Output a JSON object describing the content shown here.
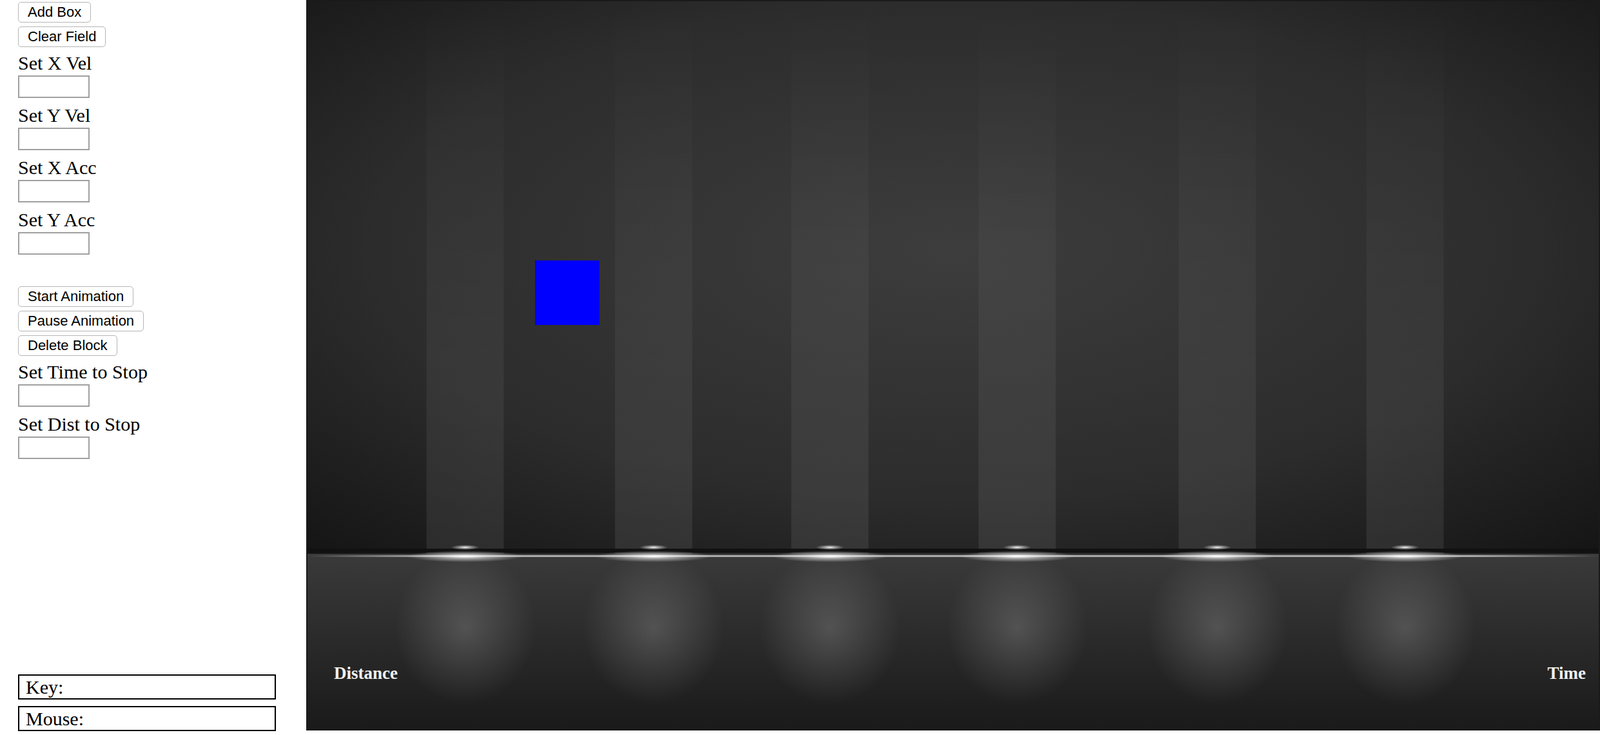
{
  "controls": {
    "groups": [
      [
        {
          "kind": "button",
          "label": "Add Box"
        },
        {
          "kind": "button",
          "label": "Clear Field"
        },
        {
          "kind": "field",
          "label": "Set X Vel",
          "value": ""
        },
        {
          "kind": "field",
          "label": "Set Y Vel",
          "value": ""
        },
        {
          "kind": "field",
          "label": "Set X Acc",
          "value": ""
        },
        {
          "kind": "field",
          "label": "Set Y Acc",
          "value": ""
        }
      ],
      [
        {
          "kind": "button",
          "label": "Start Animation"
        },
        {
          "kind": "button",
          "label": "Pause Animation"
        },
        {
          "kind": "button",
          "label": "Delete Block"
        },
        {
          "kind": "field",
          "label": "Set Time to Stop",
          "value": ""
        },
        {
          "kind": "field",
          "label": "Set Dist to Stop",
          "value": ""
        }
      ]
    ]
  },
  "readouts": [
    {
      "label": "Key:",
      "value": ""
    },
    {
      "label": "Mouse:",
      "value": ""
    }
  ],
  "stage": {
    "left_label": "Distance",
    "right_label": "Time",
    "box": {
      "color": "#0000ff"
    }
  }
}
